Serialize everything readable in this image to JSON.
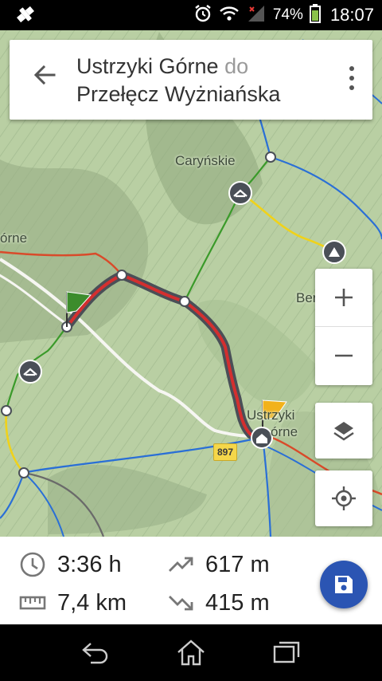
{
  "status_bar": {
    "battery_percent": "74%",
    "time": "18:07",
    "icons": [
      "gps-icon",
      "alarm-icon",
      "wifi-icon",
      "signal-icon",
      "battery-icon"
    ]
  },
  "header": {
    "origin": "Ustrzyki Górne",
    "separator": "do",
    "destination": "Przełęcz Wyżniańska",
    "back_icon": "arrow-back-icon",
    "menu_icon": "more-vert-icon"
  },
  "map": {
    "labels": {
      "carynskie": "Caryńskie",
      "gorne_left": "órne",
      "ber": "Ber",
      "ustrzyki_line1": "Ustrzyki",
      "ustrzyki_line2": "órne"
    },
    "road_number": "897",
    "colors": {
      "route": "#d32f2f",
      "route_casing": "#4a4f57",
      "green_trail": "#3a9a2a",
      "yellow_trail": "#f0d21a",
      "blue_trail": "#2a6fd6",
      "red_trail": "#d94a2a",
      "start_flag": "#3c8c2c",
      "end_flag": "#f2b21a"
    }
  },
  "controls": {
    "zoom_in": "+",
    "zoom_out": "−",
    "layers_icon": "layers-icon",
    "location_icon": "my-location-icon"
  },
  "stats": {
    "duration": "3:36 h",
    "distance": "7,4 km",
    "ascent": "617 m",
    "descent": "415 m",
    "save_icon": "save-icon"
  },
  "nav_bar": {
    "icons": [
      "back-nav-icon",
      "home-nav-icon",
      "recents-nav-icon"
    ]
  }
}
